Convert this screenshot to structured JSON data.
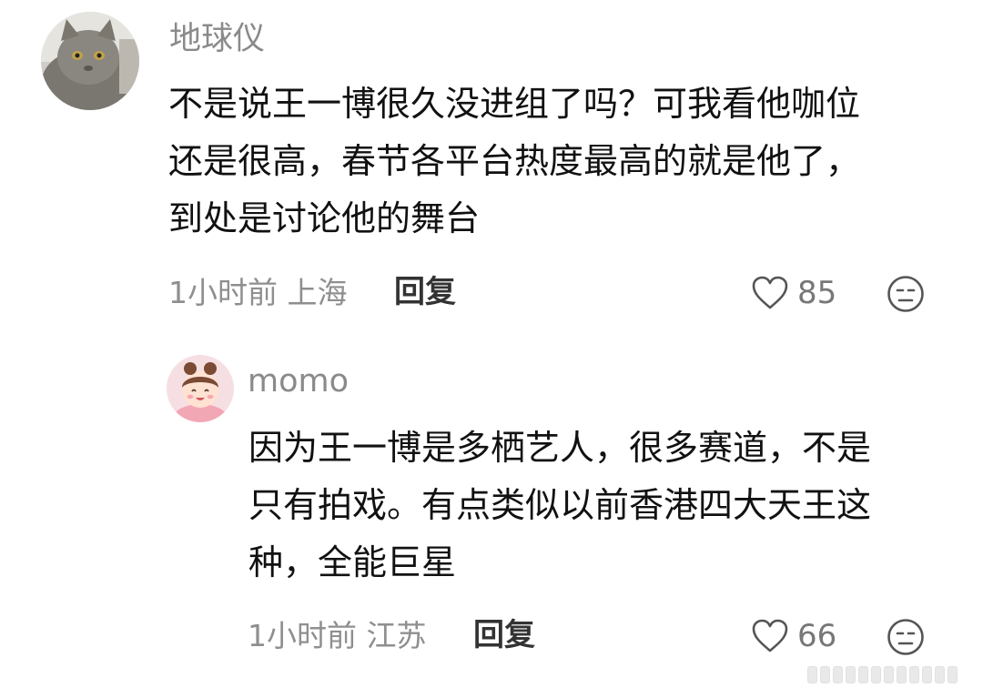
{
  "comments": [
    {
      "username": "地球仪",
      "avatar_icon": "cat-avatar-icon",
      "text_lines": [
        "不是说王一博很久没进组了吗？可我看他咖位",
        "还是很高，春节各平台热度最高的就是他了，",
        "到处是讨论他的舞台"
      ],
      "meta": "1小时前 上海",
      "reply_label": "回复",
      "like_count": "85"
    },
    {
      "username": "momo",
      "avatar_icon": "cartoon-girl-avatar-icon",
      "text_lines": [
        "因为王一博是多栖艺人，很多赛道，不是",
        "只有拍戏。有点类似以前香港四大天王这",
        "种，全能巨星"
      ],
      "meta": "1小时前 江苏",
      "reply_label": "回复",
      "like_count": "66"
    }
  ],
  "icons": {
    "like": "heart-outline-icon",
    "react": "emoji-face-icon"
  },
  "colors": {
    "username": "#8a8a8a",
    "text": "#111111",
    "meta": "#8f8f8f",
    "icon": "#555555"
  }
}
